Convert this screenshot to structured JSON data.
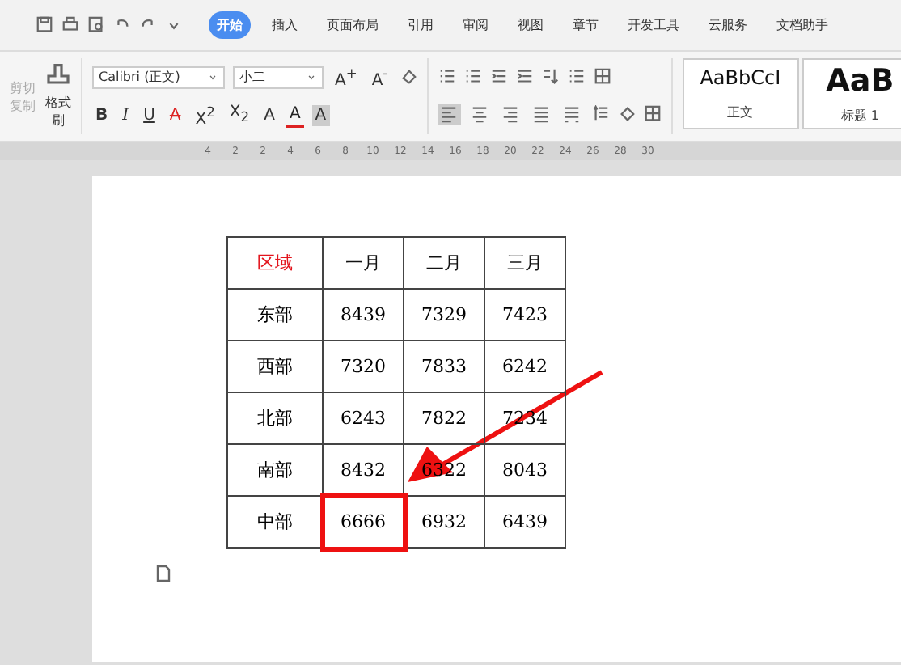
{
  "tabs": [
    {
      "label": "开始",
      "selected": true
    },
    {
      "label": "插入",
      "selected": false
    },
    {
      "label": "页面布局",
      "selected": false
    },
    {
      "label": "引用",
      "selected": false
    },
    {
      "label": "审阅",
      "selected": false
    },
    {
      "label": "视图",
      "selected": false
    },
    {
      "label": "章节",
      "selected": false
    },
    {
      "label": "开发工具",
      "selected": false
    },
    {
      "label": "云服务",
      "selected": false
    },
    {
      "label": "文档助手",
      "selected": false
    }
  ],
  "clipboard": {
    "cut": {
      "label": "剪切",
      "disabled": true
    },
    "copy": {
      "label": "复制",
      "disabled": true
    },
    "format_painter": "格式刷"
  },
  "font": {
    "name": "Calibri (正文)",
    "size": "小二",
    "grow": "A$^{+}$",
    "shrink": "A$^{-}$",
    "bold": "B",
    "italic": "I",
    "underline": "U",
    "strike": "A",
    "superscript": "X$^{2}$",
    "subscript": "X$_{2}$",
    "effects": "A",
    "font_color": "A",
    "char_shading": "A"
  },
  "alignment": [
    {
      "selected": true
    },
    {
      "selected": false
    },
    {
      "selected": false
    },
    {
      "selected": false
    },
    {
      "selected": false
    }
  ],
  "styles": [
    {
      "preview": "AaBbCcI",
      "label": "正文"
    },
    {
      "preview": "AaB",
      "label": "标题 1"
    }
  ],
  "ruler": [
    "4",
    "2",
    "2",
    "4",
    "6",
    "8",
    "10",
    "12",
    "14",
    "16",
    "18",
    "20",
    "22",
    "24",
    "26",
    "28",
    "30"
  ],
  "table": {
    "columns": [
      {
        "label": "区域",
        "color": "#e3141c"
      },
      {
        "label": "一月",
        "color": "#111111"
      },
      {
        "label": "二月",
        "color": "#111111"
      },
      {
        "label": "三月",
        "color": "#111111"
      }
    ],
    "rows": [
      [
        {
          "text": "东部",
          "boxed": false
        },
        {
          "text": "8439",
          "boxed": false
        },
        {
          "text": "7329",
          "boxed": false
        },
        {
          "text": "7423",
          "boxed": false
        }
      ],
      [
        {
          "text": "西部",
          "boxed": false
        },
        {
          "text": "7320",
          "boxed": false
        },
        {
          "text": "7833",
          "boxed": false
        },
        {
          "text": "6242",
          "boxed": false
        }
      ],
      [
        {
          "text": "北部",
          "boxed": false
        },
        {
          "text": "6243",
          "boxed": false
        },
        {
          "text": "7822",
          "boxed": false
        },
        {
          "text": "7234",
          "boxed": false
        }
      ],
      [
        {
          "text": "南部",
          "boxed": false
        },
        {
          "text": "8432",
          "boxed": false
        },
        {
          "text": "6322",
          "boxed": false
        },
        {
          "text": "8043",
          "boxed": false
        }
      ],
      [
        {
          "text": "中部",
          "boxed": false
        },
        {
          "text": "6666",
          "boxed": true
        },
        {
          "text": "6932",
          "boxed": false
        },
        {
          "text": "6439",
          "boxed": false
        }
      ]
    ]
  }
}
